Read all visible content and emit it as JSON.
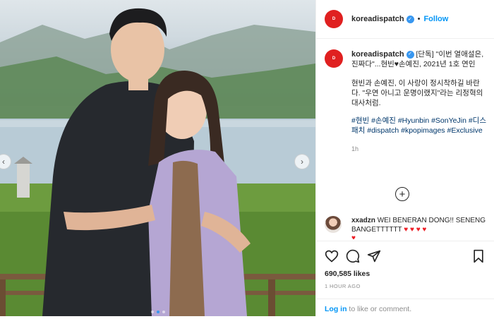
{
  "header": {
    "username": "koreadispatch",
    "bullet": "•",
    "follow_label": "Follow",
    "avatar_text": "D"
  },
  "caption": {
    "username": "koreadispatch",
    "line1": "[단독] \"이번 열애설은, 진짜다\"...현빈♥손예진, 2021년 1호 연인",
    "line2": "현빈과 손예진, 이 사랑이 정시착하길 바란다. \"우연 아니고 운명이랬지\"라는 리정혁의 대사처럼.",
    "hashtags": "#현빈 #손예진 #Hyunbin #SonYeJin #디스패치 #dispatch #kpopimages #Exclusive",
    "time": "1h"
  },
  "load_more_symbol": "+",
  "comment": {
    "username": "xxadzn",
    "text": "WEI BENERAN DONG!! SENENG BANGETTTTTT",
    "hearts": "♥ ♥ ♥ ♥",
    "clipped": "♥"
  },
  "actions": {
    "icons": [
      "heart-icon",
      "comment-icon",
      "share-icon",
      "bookmark-icon"
    ]
  },
  "likes_text": "690,585 likes",
  "posted_ago": "1 HOUR AGO",
  "login": {
    "link": "Log in",
    "rest": " to like or comment."
  },
  "carousel": {
    "prev": "‹",
    "next": "›",
    "page_count": 3,
    "active_index": 1
  },
  "colors": {
    "accent": "#0095f6",
    "avatar_red": "#e02020",
    "heart_red": "#ed1c24",
    "hashtag": "#00376b"
  }
}
